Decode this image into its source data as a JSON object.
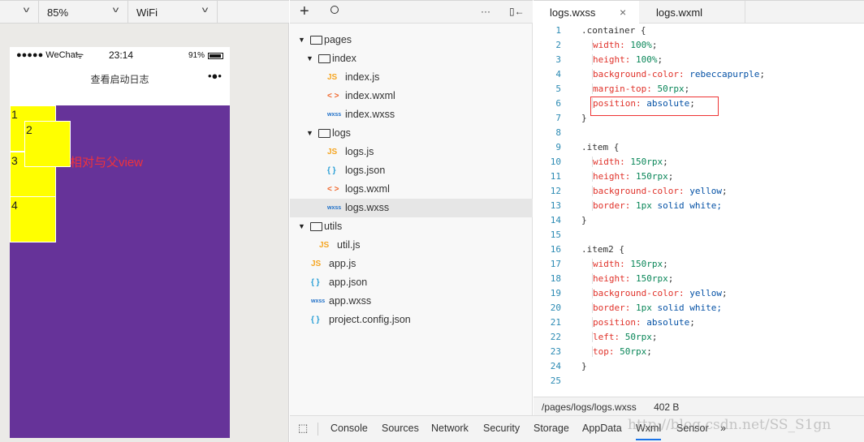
{
  "toolbar": {
    "device_value": "",
    "zoom_value": "85%",
    "network_value": "WiFi"
  },
  "phone": {
    "carrier": "●●●●● WeChat",
    "wifi_icon": "wifi-icon",
    "time": "23:14",
    "battery": "91%",
    "nav_title": "查看启动日志",
    "menu_dots": "•●•",
    "items": [
      "1",
      "2",
      "3",
      "4"
    ],
    "annotation": "相对与父view",
    "bg_color": "#663399",
    "item_color": "#ffff00"
  },
  "tree": {
    "items": [
      {
        "label": "pages",
        "type": "folder",
        "depth": 0
      },
      {
        "label": "index",
        "type": "folder",
        "depth": 1
      },
      {
        "label": "index.js",
        "type": "js",
        "depth": 2
      },
      {
        "label": "index.wxml",
        "type": "wxml",
        "depth": 2
      },
      {
        "label": "index.wxss",
        "type": "wxss",
        "depth": 2
      },
      {
        "label": "logs",
        "type": "folder",
        "depth": 1
      },
      {
        "label": "logs.js",
        "type": "js",
        "depth": 2
      },
      {
        "label": "logs.json",
        "type": "json",
        "depth": 2
      },
      {
        "label": "logs.wxml",
        "type": "wxml",
        "depth": 2
      },
      {
        "label": "logs.wxss",
        "type": "wxss",
        "depth": 2,
        "active": true
      },
      {
        "label": "utils",
        "type": "folder",
        "depth": 0
      },
      {
        "label": "util.js",
        "type": "js",
        "depth": 1
      },
      {
        "label": "app.js",
        "type": "js",
        "depth": 0
      },
      {
        "label": "app.json",
        "type": "json",
        "depth": 0
      },
      {
        "label": "app.wxss",
        "type": "wxss",
        "depth": 0
      },
      {
        "label": "project.config.json",
        "type": "json",
        "depth": 0
      }
    ]
  },
  "editor": {
    "tabs": [
      {
        "label": "logs.wxss",
        "active": true
      },
      {
        "label": "logs.wxml"
      }
    ],
    "lines": [
      [
        [
          ".container {",
          "s"
        ]
      ],
      [
        [
          "width: ",
          "p"
        ],
        [
          "100%",
          "n"
        ],
        [
          ";",
          "s"
        ]
      ],
      [
        [
          "height: ",
          "p"
        ],
        [
          "100%",
          "n"
        ],
        [
          ";",
          "s"
        ]
      ],
      [
        [
          "background-color: ",
          "p"
        ],
        [
          "rebeccapurple",
          "v"
        ],
        [
          ";",
          "s"
        ]
      ],
      [
        [
          "margin-top: ",
          "p"
        ],
        [
          "50rpx",
          "n"
        ],
        [
          ";",
          "s"
        ]
      ],
      [
        [
          "position: ",
          "p"
        ],
        [
          "absolute",
          "v"
        ],
        [
          ";",
          "s"
        ]
      ],
      [
        [
          "}",
          "s"
        ]
      ],
      [],
      [
        [
          ".item {",
          "s"
        ]
      ],
      [
        [
          "width: ",
          "p"
        ],
        [
          "150rpx",
          "n"
        ],
        [
          ";",
          "s"
        ]
      ],
      [
        [
          "height: ",
          "p"
        ],
        [
          "150rpx",
          "n"
        ],
        [
          ";",
          "s"
        ]
      ],
      [
        [
          "background-color: ",
          "p"
        ],
        [
          "yellow",
          "v"
        ],
        [
          ";",
          "s"
        ]
      ],
      [
        [
          "border: ",
          "p"
        ],
        [
          "1px",
          "n"
        ],
        [
          " solid white;",
          "v"
        ]
      ],
      [
        [
          "}",
          "s"
        ]
      ],
      [],
      [
        [
          ".item2 {",
          "s"
        ]
      ],
      [
        [
          "width: ",
          "p"
        ],
        [
          "150rpx",
          "n"
        ],
        [
          ";",
          "s"
        ]
      ],
      [
        [
          "height: ",
          "p"
        ],
        [
          "150rpx",
          "n"
        ],
        [
          ";",
          "s"
        ]
      ],
      [
        [
          "background-color: ",
          "p"
        ],
        [
          "yellow",
          "v"
        ],
        [
          ";",
          "s"
        ]
      ],
      [
        [
          "border: ",
          "p"
        ],
        [
          "1px",
          "n"
        ],
        [
          " solid white;",
          "v"
        ]
      ],
      [
        [
          "position: ",
          "p"
        ],
        [
          "absolute",
          "v"
        ],
        [
          ";",
          "s"
        ]
      ],
      [
        [
          "left: ",
          "p"
        ],
        [
          "50rpx",
          "n"
        ],
        [
          ";",
          "s"
        ]
      ],
      [
        [
          "top: ",
          "p"
        ],
        [
          "50rpx",
          "n"
        ],
        [
          ";",
          "s"
        ]
      ],
      [
        [
          "}",
          "s"
        ]
      ],
      []
    ],
    "file_path": "/pages/logs/logs.wxss",
    "file_size": "402 B"
  },
  "devtools": {
    "tabs": [
      "Console",
      "Sources",
      "Network",
      "Security",
      "Storage",
      "AppData",
      "Wxml",
      "Sensor"
    ],
    "active": "Wxml",
    "more": "»"
  },
  "watermark": "http://blog.csdn.net/SS_S1gn"
}
